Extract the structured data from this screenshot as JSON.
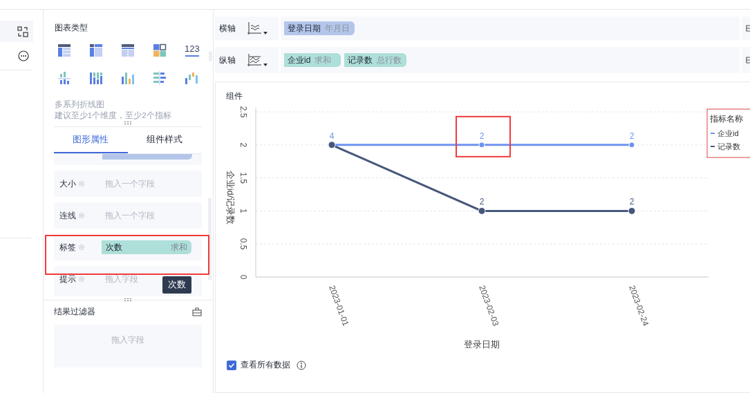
{
  "chart_type_panel": {
    "title": "图表类型",
    "number_icon_text": "123",
    "description": [
      "多系列折线图",
      "建议至少1个维度，至少2个指标"
    ]
  },
  "tabs": [
    {
      "label": "图形属性",
      "selected": true
    },
    {
      "label": "组件样式",
      "selected": false
    }
  ],
  "property_rows": [
    {
      "kind": "partial"
    },
    {
      "kind": "empty",
      "label": "大小",
      "placeholder": "拖入一个字段"
    },
    {
      "kind": "empty",
      "label": "连线",
      "placeholder": "拖入一个字段"
    },
    {
      "kind": "field",
      "label": "标签",
      "field": "次数",
      "aggregation": "求和",
      "highlighted": true,
      "tooltip": "次数"
    },
    {
      "kind": "empty",
      "label": "提示",
      "placeholder": "拖入字段"
    },
    {
      "kind": "partial"
    }
  ],
  "result_filter": {
    "title": "结果过滤器",
    "placeholder": "拖入字段"
  },
  "axes": [
    {
      "label": "横轴",
      "fields": [
        {
          "name": "登录日期",
          "aggregation": "年月日",
          "kind": "dimension"
        }
      ]
    },
    {
      "label": "纵轴",
      "fields": [
        {
          "name": "企业id",
          "aggregation": "求和",
          "kind": "measure"
        },
        {
          "name": "记录数",
          "aggregation": "总行数",
          "kind": "measure"
        }
      ]
    }
  ],
  "component": {
    "title": "组件",
    "show_all_data": {
      "label": "查看所有数据",
      "checked": true
    },
    "chart_data": {
      "type": "line",
      "xlabel": "登录日期",
      "ylabel": "企业id/记录数",
      "categories": [
        "2023-01-01",
        "2023-02-03",
        "2023-02-24"
      ],
      "series": [
        {
          "name": "企业id",
          "color": "#6e93ef",
          "values": [
            2,
            2,
            2
          ],
          "marker": "circle"
        },
        {
          "name": "记录数",
          "color": "#46577a",
          "values": [
            2,
            1,
            1
          ],
          "marker": "circle"
        }
      ],
      "ylim": [
        0,
        2.5
      ],
      "yticks": [
        0,
        0.5,
        1,
        1.5,
        2,
        2.5
      ],
      "grid": true,
      "legend": {
        "title": "指标名称"
      }
    },
    "point_labels": [
      {
        "labels": [
          "4"
        ],
        "highlighted": false
      },
      {
        "labels": [
          "2",
          "2"
        ],
        "highlighted": true
      },
      {
        "labels": [
          "2",
          "2"
        ],
        "highlighted": false
      }
    ]
  }
}
